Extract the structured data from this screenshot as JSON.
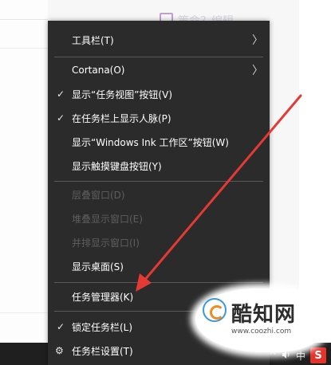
{
  "background": {
    "top_right_text": "策命？编辑"
  },
  "menu": {
    "items": [
      {
        "label": "工具栏(T)",
        "has_arrow": true
      },
      {
        "label": "Cortana(O)",
        "has_arrow": true
      },
      {
        "label": "显示“任务视图”按钮(V)",
        "checked": true
      },
      {
        "label": "在任务栏上显示人脉(P)",
        "checked": true
      },
      {
        "label": "显示“Windows Ink 工作区”按钮(W)"
      },
      {
        "label": "显示触摸键盘按钮(Y)"
      },
      {
        "label": "层叠窗口(D)",
        "disabled": true
      },
      {
        "label": "堆叠显示窗口(E)",
        "disabled": true
      },
      {
        "label": "并排显示窗口(I)",
        "disabled": true
      },
      {
        "label": "显示桌面(S)"
      },
      {
        "label": "任务管理器(K)"
      },
      {
        "label": "锁定任务栏(L)",
        "checked": true
      },
      {
        "label": "任务栏设置(T)"
      }
    ],
    "check_glyph": "✓",
    "arrow_glyph": "〉",
    "gear_glyph": "⚙"
  },
  "tray": {
    "chevron": "^",
    "volume_icon": "speaker-icon",
    "ime": "中",
    "app_letter": "S"
  },
  "watermark": {
    "brand": "酷知网",
    "url": "www.coozhi.com"
  },
  "colors": {
    "menu_bg": "#2b2b2b",
    "menu_text": "#ffffff",
    "disabled_text": "#5e5e5e",
    "arrow": "#e53935",
    "taskbar": "#1f1f1f"
  }
}
